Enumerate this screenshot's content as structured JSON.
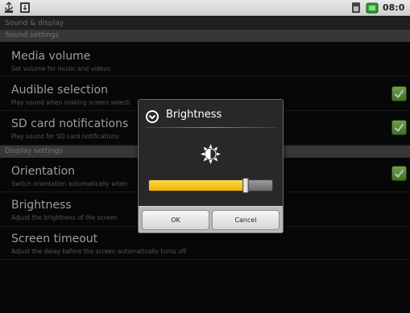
{
  "status_bar": {
    "time": "08:0",
    "left_icons": [
      "usb-icon",
      "download-icon"
    ],
    "right_icons": [
      "sim-icon",
      "battery-icon"
    ]
  },
  "screen_title": "Sound & display",
  "sections": {
    "sound": {
      "header": "Sound settings"
    },
    "display": {
      "header": "Display settings"
    }
  },
  "prefs": {
    "media_volume": {
      "title": "Media volume",
      "summary": "Set volume for music and videos"
    },
    "audible_selection": {
      "title": "Audible selection",
      "summary": "Play sound when making screen selecti",
      "checked": true
    },
    "sd_card": {
      "title": "SD card notifications",
      "summary": "Play sound for SD card notifications",
      "checked": true
    },
    "orientation": {
      "title": "Orientation",
      "summary": "Switch orientation automatically when",
      "checked": true
    },
    "brightness": {
      "title": "Brightness",
      "summary": "Adjust the brightness of the screen"
    },
    "screen_timeout": {
      "title": "Screen timeout",
      "summary": "Adjust the delay before the screen automatically turns off"
    }
  },
  "dialog": {
    "title": "Brightness",
    "title_icon": "dialog-menu-icon",
    "brightness_icon": "brightness-sun-icon",
    "slider_level": 0.78,
    "ok_label": "OK",
    "cancel_label": "Cancel"
  },
  "colors": {
    "slider_fill": "#f2b300",
    "checkbox": "#4b9a2a"
  }
}
